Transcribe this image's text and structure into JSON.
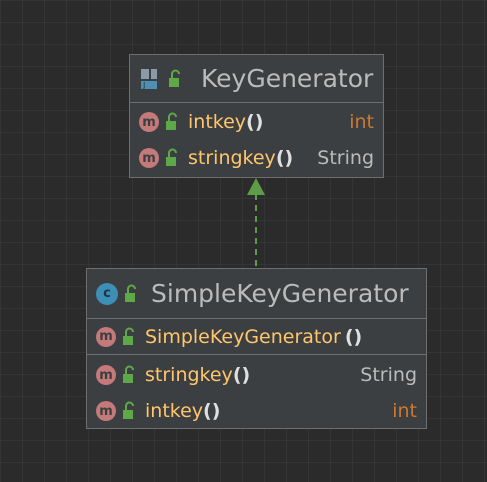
{
  "interface_box": {
    "title": "KeyGenerator",
    "icon": "interface-icon",
    "methods": [
      {
        "name": "intkey",
        "parens": "()",
        "return_type": "int"
      },
      {
        "name": "stringkey",
        "parens": "()",
        "return_type": "String"
      }
    ]
  },
  "class_box": {
    "title": "SimpleKeyGenerator",
    "icon_letter": "c",
    "constructor": {
      "name": "SimpleKeyGenerator",
      "parens": "()"
    },
    "methods": [
      {
        "name": "stringkey",
        "parens": "()",
        "return_type": "String"
      },
      {
        "name": "intkey",
        "parens": "()",
        "return_type": "int"
      }
    ]
  },
  "method_badge_letter": "m",
  "relationship": "implements",
  "colors": {
    "background": "#2b2b2b",
    "box_fill": "#3c3f41",
    "method_name": "#ffc66d",
    "type_int": "#cc7832",
    "arrow": "#5e9c48"
  }
}
